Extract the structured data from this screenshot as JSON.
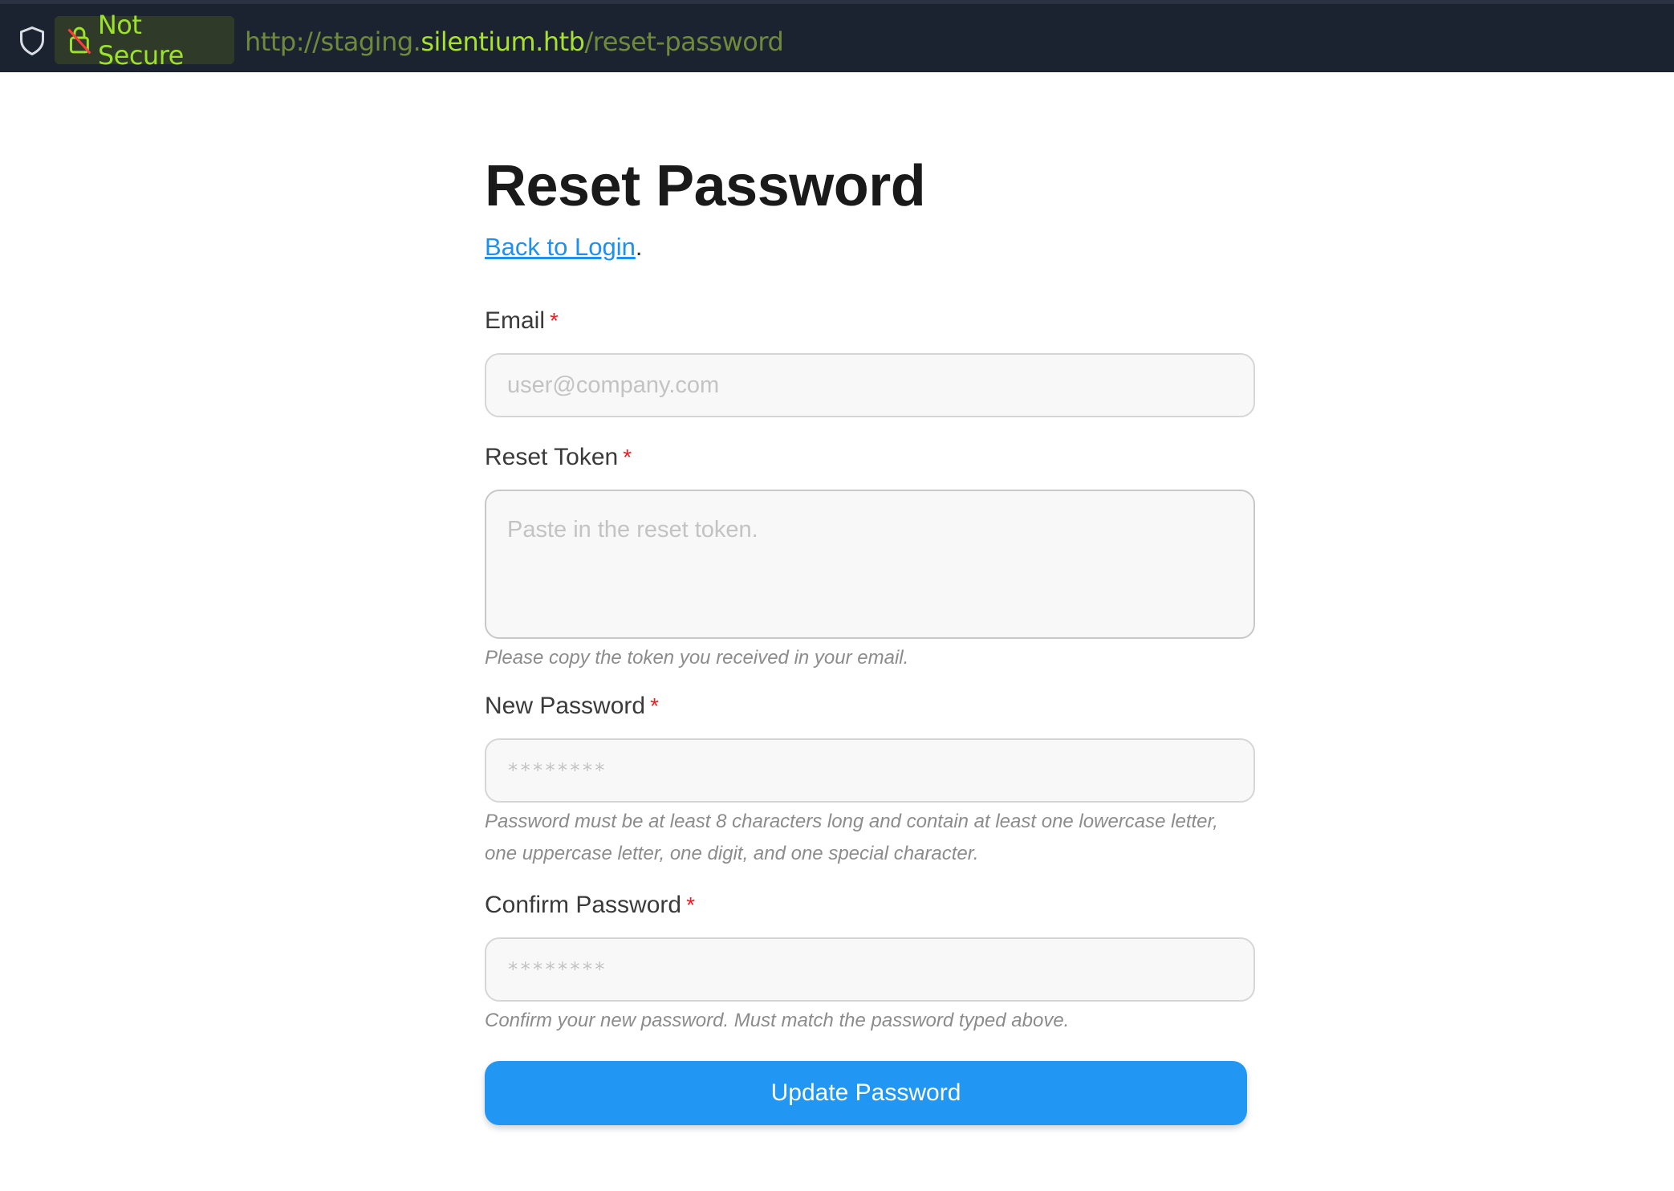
{
  "browser": {
    "security_label": "Not Secure",
    "url": {
      "scheme": "http://staging.",
      "host": "silentium.htb",
      "path": "/reset-password"
    }
  },
  "page": {
    "title": "Reset Password",
    "back_link": "Back to Login",
    "back_suffix": ".",
    "required_mark": "*",
    "email": {
      "label": "Email",
      "placeholder": "user@company.com",
      "value": ""
    },
    "reset_token": {
      "label": "Reset Token",
      "placeholder": "Paste in the reset token.",
      "value": "",
      "help": "Please copy the token you received in your email."
    },
    "new_password": {
      "label": "New Password",
      "placeholder": "********",
      "value": "",
      "help": "Password must be at least 8 characters long and contain at least one lowercase letter, one uppercase letter, one digit, and one special character."
    },
    "confirm_password": {
      "label": "Confirm Password",
      "placeholder": "********",
      "value": "",
      "help": "Confirm your new password. Must match the password typed above."
    },
    "submit_label": "Update Password"
  },
  "colors": {
    "urlbar_bg": "#1c2330",
    "security_green": "#9be22a",
    "link_blue": "#1e90f0",
    "button_blue": "#2196f3",
    "required_red": "#e02424"
  }
}
